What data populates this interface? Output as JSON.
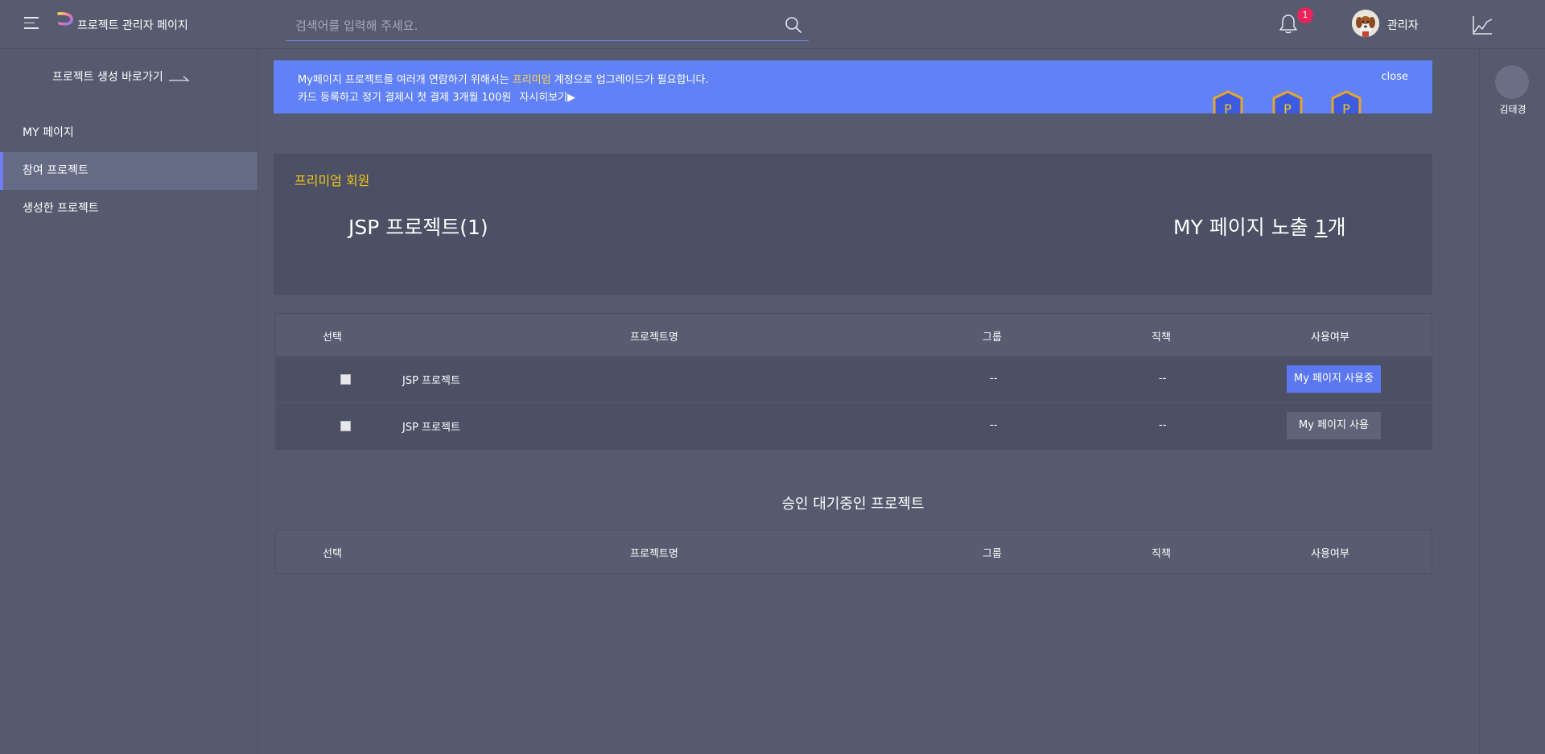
{
  "app": {
    "title": "프로젝트 관리자 페이지"
  },
  "search": {
    "placeholder": "검색어를 입력해 주세요."
  },
  "header": {
    "notification_count": "1",
    "user_name": "관리자"
  },
  "sidebar": {
    "shortcut": "프로젝트 생성 바로가기",
    "items": [
      {
        "label": "MY 페이지"
      },
      {
        "label": "참여 프로젝트",
        "active": true
      },
      {
        "label": "생성한 프로젝트"
      }
    ]
  },
  "rail": {
    "name": "김태경"
  },
  "banner": {
    "line1_prefix": "My페이지 프로젝트를 여러개 연람하기 위해서는 ",
    "line1_highlight": "프리미엄",
    "line1_suffix": " 계정으로 업그레이드가 필요합니다.",
    "line2": "카드 등록하고 정기 결제시 첫 결제 3개월 100원",
    "more": "자시히보기▶",
    "close": "close",
    "medal_letter": "P"
  },
  "premium_card": {
    "label": "프리미엄 회원",
    "project": "JSP 프로젝트(1)",
    "exposure_prefix": "MY 페이지 노출 ",
    "exposure_count": "1",
    "exposure_suffix": "개"
  },
  "participating_table": {
    "headers": {
      "select": "선택",
      "name": "프로젝트명",
      "group": "그룹",
      "role": "직책",
      "usage": "사용여부"
    },
    "rows": [
      {
        "name": "JSP 프로젝트",
        "group": "--",
        "role": "--",
        "button": "My 페이지 사용중"
      },
      {
        "name": "JSP 프로젝트",
        "group": "--",
        "role": "--",
        "button": "My 페이지 사용"
      }
    ]
  },
  "pending_section": {
    "title": "승인 대기중인 프로젝트"
  },
  "pending_table": {
    "headers": {
      "select": "선택",
      "name": "프로젝트명",
      "group": "그룹",
      "role": "직책",
      "usage": "사용여부"
    }
  },
  "colors": {
    "accent": "#6181f7",
    "premium": "#f5c518",
    "badge": "#e8245a"
  }
}
